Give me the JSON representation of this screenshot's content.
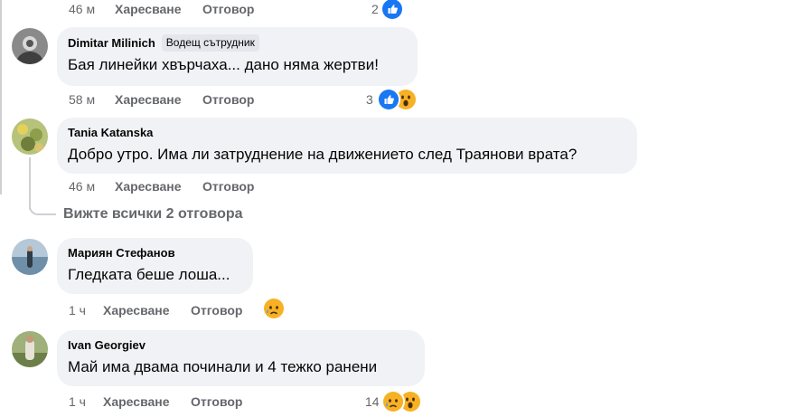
{
  "comments": [
    {
      "time": "46 м",
      "like_label": "Харесване",
      "reply_label": "Отговор",
      "reaction_count": "2",
      "reactions": [
        "like-icon"
      ]
    },
    {
      "author": "Dimitar Milinich",
      "badge": "Водещ сътрудник",
      "text": "Бая линейки хвърчаха... дано няма жертви!",
      "time": "58 м",
      "like_label": "Харесване",
      "reply_label": "Отговор",
      "reaction_count": "3",
      "reactions": [
        "like-icon",
        "wow-icon"
      ]
    },
    {
      "author": "Tania Katanska",
      "text": "Добро утро. Има ли затруднение на движението след Траянови врата?",
      "time": "46 м",
      "like_label": "Харесване",
      "reply_label": "Отговор",
      "view_replies": "Вижте всички 2 отговора"
    },
    {
      "author": "Мариян Стефанов",
      "text": "Гледката беше лоша...",
      "time": "1 ч",
      "like_label": "Харесване",
      "reply_label": "Отговор",
      "reactions": [
        "sad-icon"
      ]
    },
    {
      "author": "Ivan Georgiev",
      "text": "Май има двама починали и 4 тежко ранени",
      "time": "1 ч",
      "like_label": "Харесване",
      "reply_label": "Отговор",
      "reaction_count": "14",
      "reactions": [
        "sad-icon",
        "wow-icon"
      ]
    }
  ],
  "colors": {
    "bubble": "#f0f2f5",
    "meta_text": "#65676b",
    "like_blue": "#1877f2",
    "emoji_yellow": "#f7b125"
  }
}
